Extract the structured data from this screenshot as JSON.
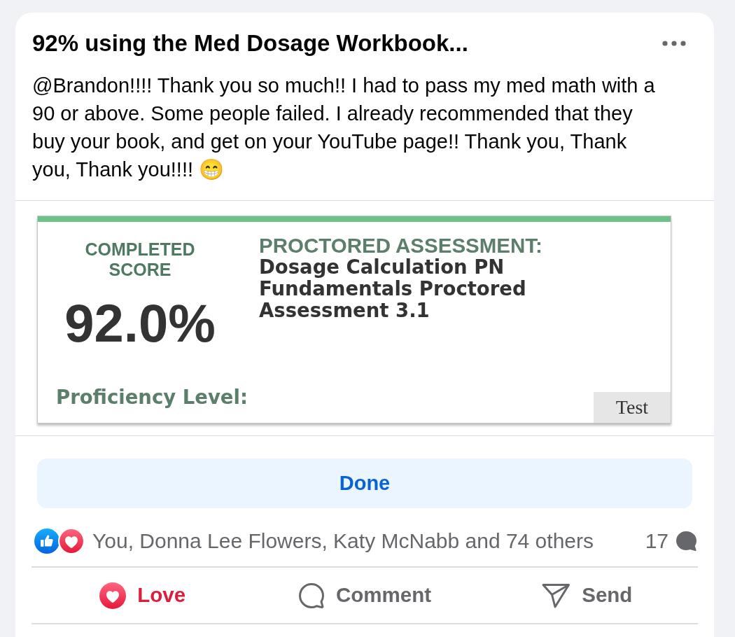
{
  "post": {
    "title": "92% using the Med Dosage Workbook...",
    "body": "@Brandon!!!! Thank you so much!! I had to pass my med math with a 90 or above. Some people failed. I already recommended that they buy your book, and get on your YouTube page!! Thank you, Thank you, Thank you!!!! 😁"
  },
  "attachment": {
    "score_label": "COMPLETED SCORE",
    "score": "92.0%",
    "proficiency_label": "Proficiency Level:",
    "assessment_heading": "PROCTORED ASSESSMENT:",
    "assessment_name": "Dosage Calculation PN Fundamentals Proctored Assessment 3.1",
    "tag": "Test"
  },
  "done_button": {
    "label": "Done"
  },
  "reactions": {
    "summary": "You, Donna Lee Flowers, Katy McNabb and 74 others",
    "comment_count": "17"
  },
  "actions": [
    {
      "kind": "react",
      "label": "Love",
      "active": true
    },
    {
      "kind": "comment",
      "label": "Comment",
      "active": false
    },
    {
      "kind": "send",
      "label": "Send",
      "active": false
    }
  ]
}
